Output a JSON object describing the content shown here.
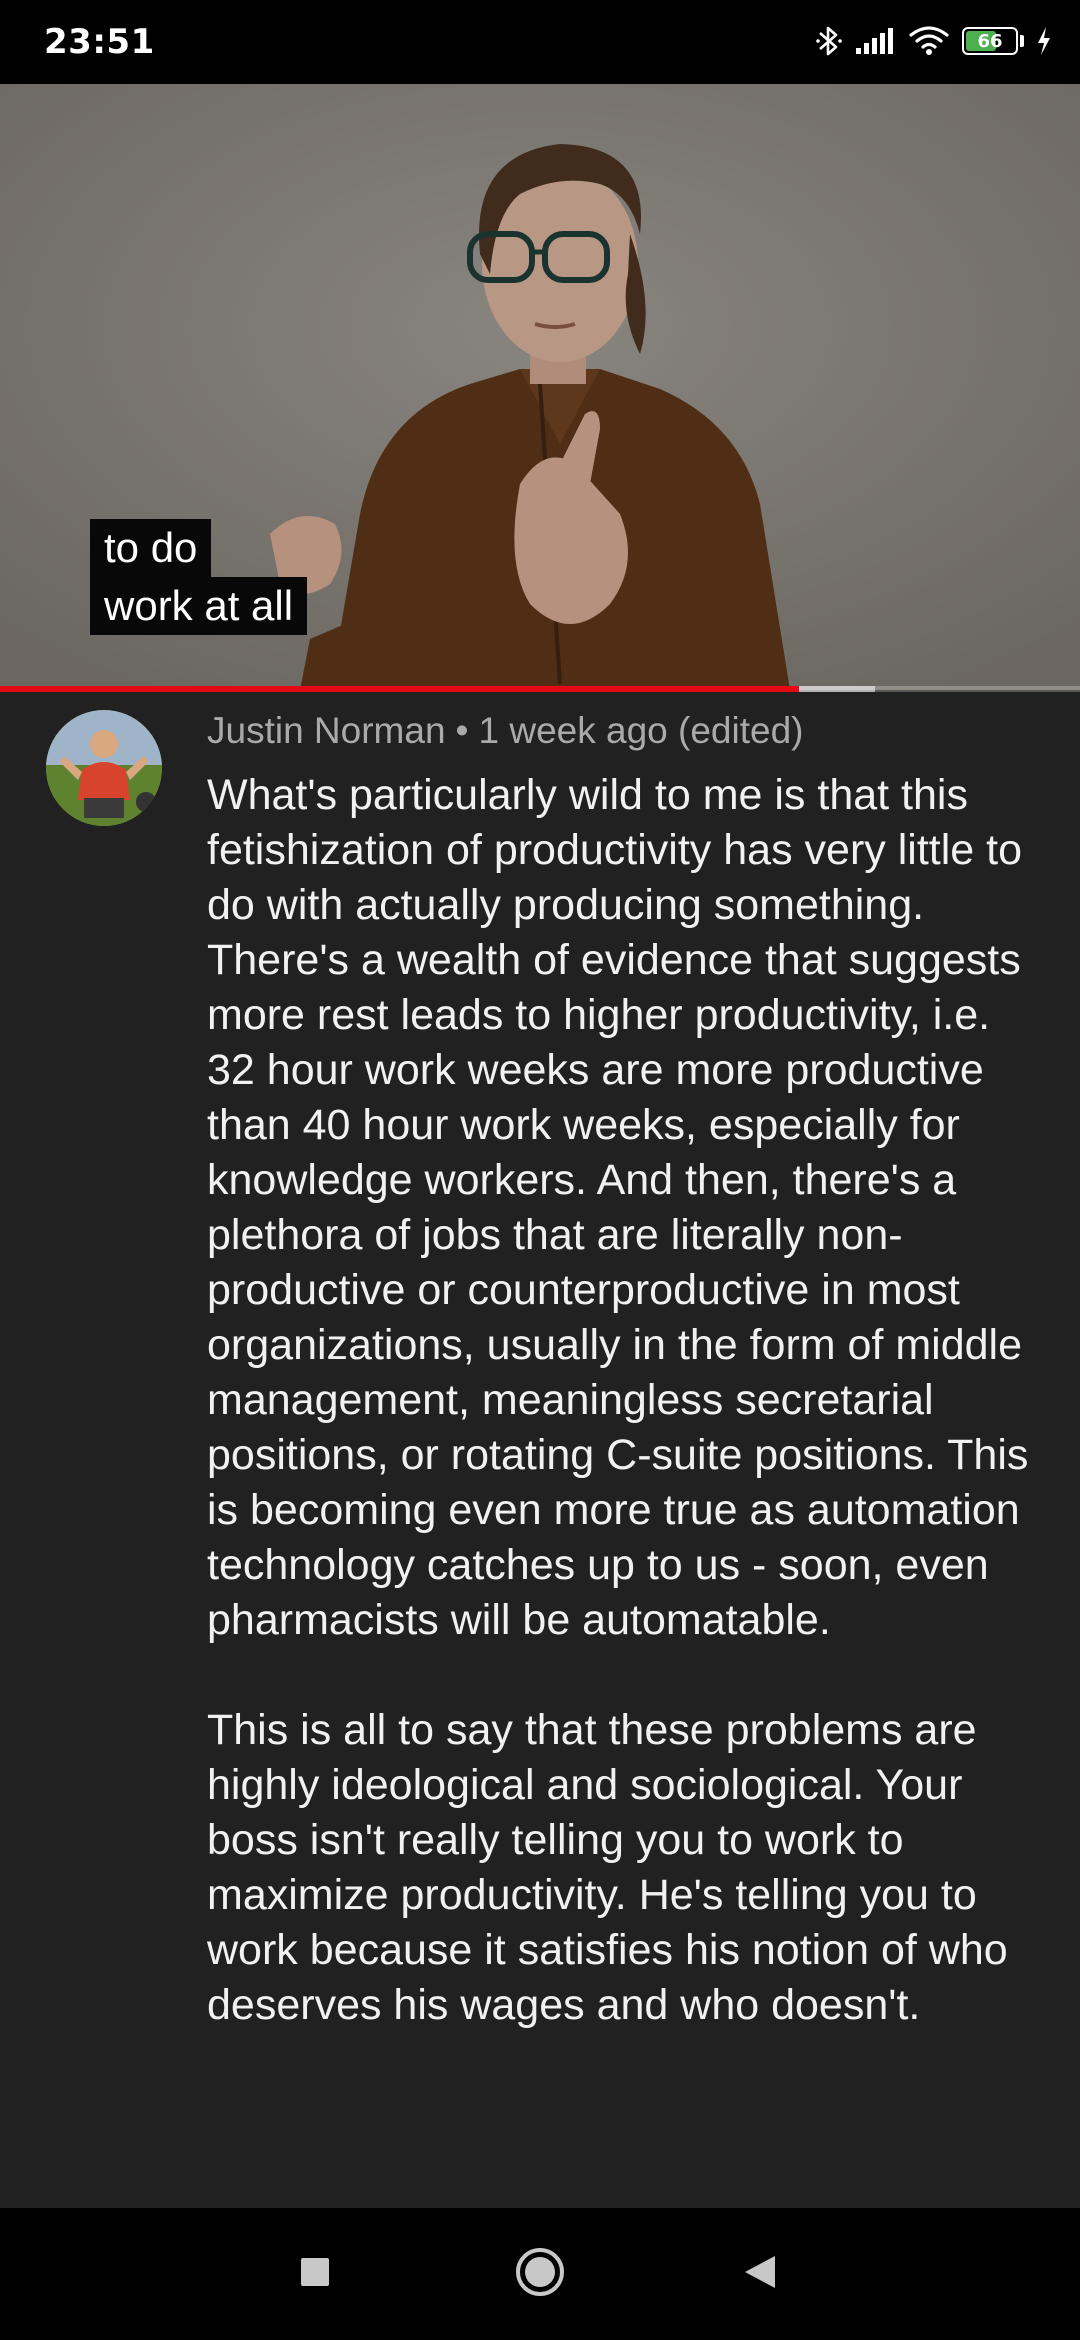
{
  "status_bar": {
    "time": "23:51",
    "battery_level": "66",
    "battery_fraction": 0.66,
    "icons": [
      "bluetooth-icon",
      "signal-icon",
      "wifi-icon",
      "battery-icon",
      "charging-icon"
    ]
  },
  "video": {
    "caption_lines": [
      "to do",
      "work at all"
    ],
    "progress_played_fraction": 0.74,
    "progress_buffered_fraction": 0.81,
    "progress_color": "#e50914"
  },
  "comment": {
    "author": "Justin Norman",
    "separator": "•",
    "timestamp": "1 week ago (edited)",
    "paragraphs": [
      "What's particularly wild to me is that this fetishization of productivity has very little to do with actually producing something. There's a wealth of evidence that suggests more rest leads to higher productivity, i.e. 32 hour work weeks are more productive than 40 hour work weeks, especially for knowledge workers. And then, there's a plethora of jobs that are literally non-productive or counterproductive in most organizations, usually in the form of middle management, meaningless secretarial positions, or rotating C-suite positions. This is becoming even more true as automation technology catches up to us - soon, even pharmacists will be automatable.",
      "This is all to say that these problems are highly ideological and sociological. Your boss isn't really telling you to work to maximize productivity. He's telling you to work because it satisfies his notion of who deserves his wages and who doesn't."
    ]
  },
  "nav_bar": {
    "buttons": [
      "recents-button",
      "home-button",
      "back-button"
    ]
  },
  "colors": {
    "background": "#212121",
    "text_primary": "#f1f1f1",
    "text_secondary": "#aaaaaa",
    "battery_green": "#4caf50"
  }
}
